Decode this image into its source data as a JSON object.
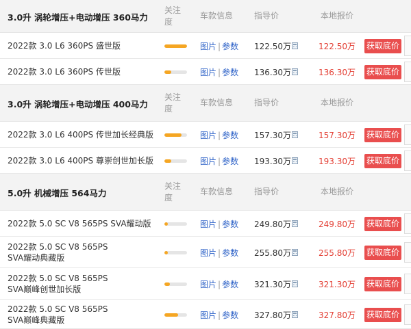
{
  "header": {
    "attention_label": "关注度",
    "info_label": "车款信息",
    "guide_price_label": "指导价",
    "local_price_label": "本地报价"
  },
  "links": {
    "pics": "图片",
    "sep": "|",
    "params": "参数"
  },
  "button_label": "获取底价",
  "colors": {
    "accent_red": "#e94e4e",
    "price_red": "#e33e33",
    "link_blue": "#2c61c7",
    "bar_orange": "#f5a623"
  },
  "groups": [
    {
      "title": "3.0升 涡轮增压+电动增压 360马力",
      "rows": [
        {
          "model": "2022款 3.0 L6 360PS 盛世版",
          "attention": 1.0,
          "guide_price": "122.50万",
          "local_price": "122.50万"
        },
        {
          "model": "2022款 3.0 L6 360PS 传世版",
          "attention": 0.3,
          "guide_price": "136.30万",
          "local_price": "136.30万"
        }
      ]
    },
    {
      "title": "3.0升 涡轮增压+电动增压 400马力",
      "rows": [
        {
          "model": "2022款 3.0 L6 400PS 传世加长经典版",
          "attention": 0.75,
          "guide_price": "157.30万",
          "local_price": "157.30万"
        },
        {
          "model": "2022款 3.0 L6 400PS 尊崇创世加长版",
          "attention": 0.3,
          "guide_price": "193.30万",
          "local_price": "193.30万"
        }
      ]
    },
    {
      "title": "5.0升 机械增压 564马力",
      "rows": [
        {
          "model": "2022款 5.0 SC V8 565PS SVA耀动版",
          "attention": 0.15,
          "guide_price": "249.80万",
          "local_price": "249.80万"
        },
        {
          "model": "2022款 5.0 SC V8 565PS SVA耀动典藏版",
          "attention": 0.15,
          "guide_price": "255.80万",
          "local_price": "255.80万"
        },
        {
          "model": "2022款 5.0 SC V8 565PS SVA巅峰创世加长版",
          "attention": 0.25,
          "guide_price": "321.30万",
          "local_price": "321.30万"
        },
        {
          "model": "2022款 5.0 SC V8 565PS SVA巅峰典藏版",
          "attention": 0.6,
          "guide_price": "327.80万",
          "local_price": "327.80万"
        }
      ]
    }
  ]
}
